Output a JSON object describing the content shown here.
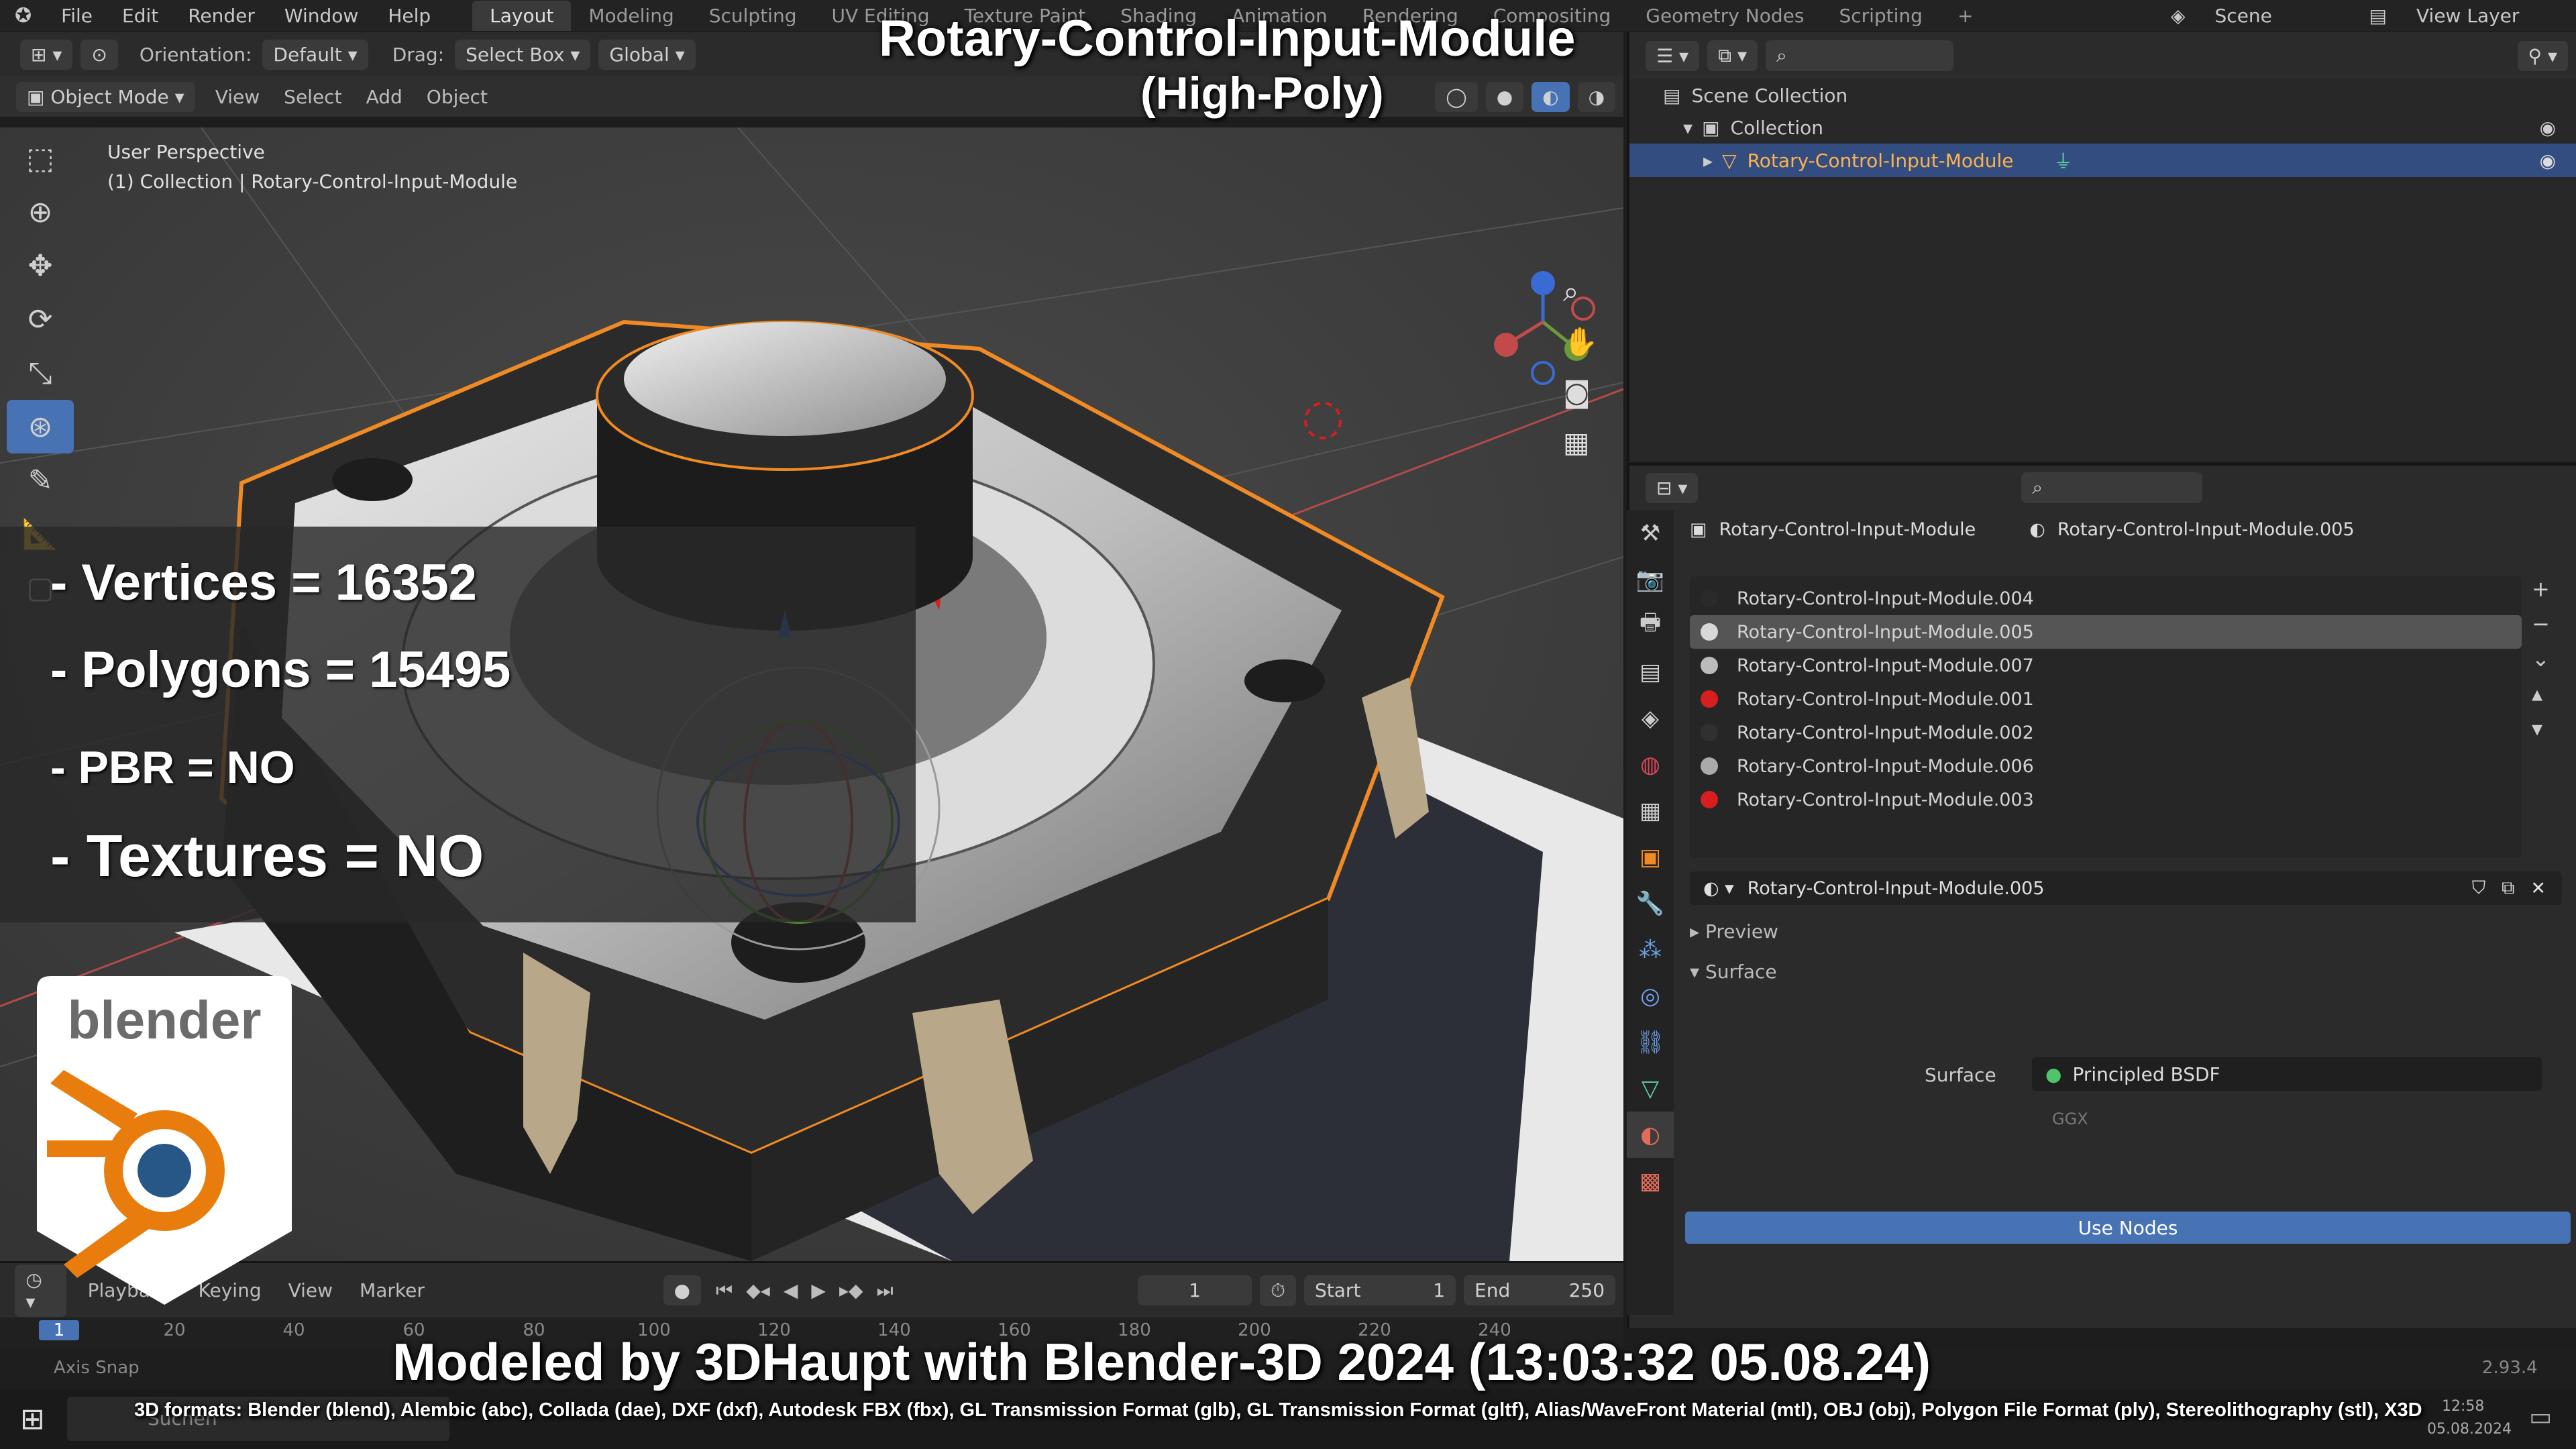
{
  "menu": [
    "File",
    "Edit",
    "Render",
    "Window",
    "Help"
  ],
  "workspaces": [
    "Layout",
    "Modeling",
    "Sculpting",
    "UV Editing",
    "Texture Paint",
    "Shading",
    "Animation",
    "Rendering",
    "Compositing",
    "Geometry Nodes",
    "Scripting"
  ],
  "scene": {
    "label": "Scene",
    "view_layer": "View Layer"
  },
  "toolheader": {
    "orientation_label": "Orientation:",
    "orientation_value": "Default",
    "drag_label": "Drag:",
    "drag_value": "Select Box",
    "transform": "Global"
  },
  "viewheader": {
    "mode": "Object Mode",
    "items": [
      "View",
      "Select",
      "Add",
      "Object"
    ]
  },
  "viewport": {
    "perspective": "User Perspective",
    "collection_info": "(1) Collection | Rotary-Control-Input-Module"
  },
  "overlay": {
    "title": "Rotary-Control-Input-Module",
    "subtitle": "(High-Poly)",
    "stats": [
      "- Vertices = 16352",
      "- Polygons = 15495",
      "- PBR =  NO",
      "- Textures = NO"
    ],
    "logo_text": "blender",
    "credit": "Modeled by 3DHaupt with Blender-3D 2024 (13:03:32  05.08.24)",
    "formats": "3D formats: Blender (blend), Alembic (abc), Collada (dae), DXF (dxf), Autodesk FBX (fbx), GL Transmission Format (glb), GL Transmission Format (gltf), Alias/WaveFront Material (mtl), OBJ (obj), Polygon File Format (ply), Stereolithography (stl), X3D"
  },
  "outliner": {
    "root": "Scene Collection",
    "collection": "Collection",
    "object": "Rotary-Control-Input-Module"
  },
  "properties": {
    "object": "Rotary-Control-Input-Module",
    "material": "Rotary-Control-Input-Module.005",
    "slots": [
      {
        "name": "Rotary-Control-Input-Module.004",
        "color": "#2a2a2a"
      },
      {
        "name": "Rotary-Control-Input-Module.005",
        "color": "#d8d8d8"
      },
      {
        "name": "Rotary-Control-Input-Module.007",
        "color": "#bbbbbb"
      },
      {
        "name": "Rotary-Control-Input-Module.001",
        "color": "#d81e1e"
      },
      {
        "name": "Rotary-Control-Input-Module.002",
        "color": "#303030"
      },
      {
        "name": "Rotary-Control-Input-Module.006",
        "color": "#aaaaaa"
      },
      {
        "name": "Rotary-Control-Input-Module.003",
        "color": "#d81e1e"
      }
    ],
    "preview": "Preview",
    "surface_section": "Surface",
    "use_nodes": "Use Nodes",
    "surface_label": "Surface",
    "surface_value": "Principled BSDF",
    "ggx": "GGX"
  },
  "timeline": {
    "playback": "Playback",
    "keying": "Keying",
    "view": "View",
    "marker": "Marker",
    "current_frame": "1",
    "start_label": "Start",
    "start": "1",
    "end_label": "End",
    "end": "250"
  },
  "ruler": [
    "1",
    "20",
    "40",
    "60",
    "80",
    "100",
    "120",
    "140",
    "160",
    "180",
    "200",
    "220",
    "240"
  ],
  "status": {
    "left": "Axis Snap",
    "version": "2.93.4"
  },
  "taskbar": {
    "search": "Suchen",
    "time": "12:58",
    "date": "05.08.2024"
  }
}
